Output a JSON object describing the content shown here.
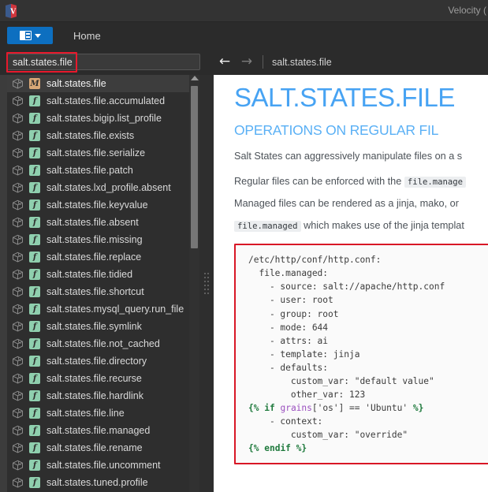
{
  "window": {
    "title": "Velocity (",
    "app_icon": "velocity-book-icon"
  },
  "toolbar": {
    "sidebar_toggle_icon": "sidebar-layout-icon",
    "sidebar_toggle_caret": "chevron-down-icon",
    "home_label": "Home"
  },
  "search": {
    "value": "salt.states.file",
    "placeholder": ""
  },
  "nav": {
    "back_icon": "arrow-left-icon",
    "forward_icon": "arrow-right-icon",
    "breadcrumb": "salt.states.file"
  },
  "sidebar": {
    "scroll_up_icon": "triangle-up-icon",
    "items": [
      {
        "label": "salt.states.file",
        "type": "M",
        "selected": true
      },
      {
        "label": "salt.states.file.accumulated",
        "type": "f",
        "selected": false
      },
      {
        "label": "salt.states.bigip.list_profile",
        "type": "f",
        "selected": false
      },
      {
        "label": "salt.states.file.exists",
        "type": "f",
        "selected": false
      },
      {
        "label": "salt.states.file.serialize",
        "type": "f",
        "selected": false
      },
      {
        "label": "salt.states.file.patch",
        "type": "f",
        "selected": false
      },
      {
        "label": "salt.states.lxd_profile.absent",
        "type": "f",
        "selected": false
      },
      {
        "label": "salt.states.file.keyvalue",
        "type": "f",
        "selected": false
      },
      {
        "label": "salt.states.file.absent",
        "type": "f",
        "selected": false
      },
      {
        "label": "salt.states.file.missing",
        "type": "f",
        "selected": false
      },
      {
        "label": "salt.states.file.replace",
        "type": "f",
        "selected": false
      },
      {
        "label": "salt.states.file.tidied",
        "type": "f",
        "selected": false
      },
      {
        "label": "salt.states.file.shortcut",
        "type": "f",
        "selected": false
      },
      {
        "label": "salt.states.mysql_query.run_file",
        "type": "f",
        "selected": false
      },
      {
        "label": "salt.states.file.symlink",
        "type": "f",
        "selected": false
      },
      {
        "label": "salt.states.file.not_cached",
        "type": "f",
        "selected": false
      },
      {
        "label": "salt.states.file.directory",
        "type": "f",
        "selected": false
      },
      {
        "label": "salt.states.file.recurse",
        "type": "f",
        "selected": false
      },
      {
        "label": "salt.states.file.hardlink",
        "type": "f",
        "selected": false
      },
      {
        "label": "salt.states.file.line",
        "type": "f",
        "selected": false
      },
      {
        "label": "salt.states.file.managed",
        "type": "f",
        "selected": false
      },
      {
        "label": "salt.states.file.rename",
        "type": "f",
        "selected": false
      },
      {
        "label": "salt.states.file.uncomment",
        "type": "f",
        "selected": false
      },
      {
        "label": "salt.states.tuned.profile",
        "type": "f",
        "selected": false
      }
    ]
  },
  "content": {
    "h1": "SALT.STATES.FILE",
    "h2": "OPERATIONS ON REGULAR FIL",
    "para1": "Salt States can aggressively manipulate files on a s",
    "para2_pre": "Regular files can be enforced with the",
    "para2_code": "file.manage",
    "para3_pre": "Managed files can be rendered as a jinja, mako, or",
    "para4_code": "file.managed",
    "para4_post": "which makes use of the jinja templat",
    "code_block": "/etc/http/conf/http.conf:\n  file.managed:\n    - source: salt://apache/http.conf\n    - user: root\n    - group: root\n    - mode: 644\n    - attrs: ai\n    - template: jinja\n    - defaults:\n        custom_var: \"default value\"\n        other_var: 123\n{% if grains['os'] == 'Ubuntu' %}\n    - context:\n        custom_var: \"override\"\n{% endif %}"
  },
  "colors": {
    "accent_blue": "#47a3f3",
    "toggle_blue": "#0d6fc0",
    "annotation_red": "#d81726",
    "badge_function": "#8fcfae",
    "badge_module": "#d9a877",
    "chrome_dark": "#2b2b2b"
  }
}
